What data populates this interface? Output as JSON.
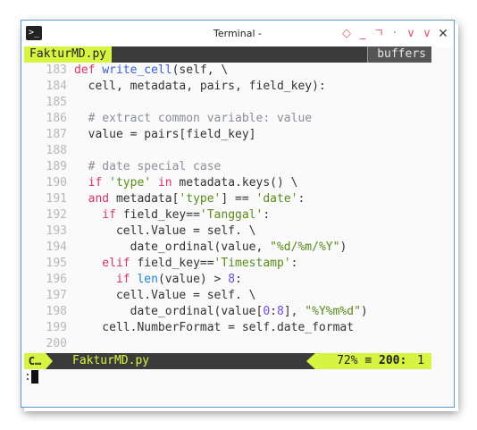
{
  "window": {
    "title": "Terminal -",
    "icon": "terminal-icon"
  },
  "window_buttons": [
    "◇",
    "_",
    "ㄱ",
    "·",
    "∨",
    "∨"
  ],
  "tabline": {
    "active_tab": "FakturMD.py",
    "buffers_label": "buffers"
  },
  "lines": [
    {
      "n": "183",
      "segs": [
        [
          "kw",
          "def "
        ],
        [
          "fn",
          "write_cell"
        ],
        [
          "",
          "(self, \\"
        ]
      ]
    },
    {
      "n": "184",
      "segs": [
        [
          "",
          "  cell, metadata, pairs, field_key):"
        ]
      ]
    },
    {
      "n": "185",
      "segs": []
    },
    {
      "n": "186",
      "segs": [
        [
          "cm",
          "  # extract common variable: value"
        ]
      ]
    },
    {
      "n": "187",
      "segs": [
        [
          "",
          "  value = pairs[field_key]"
        ]
      ]
    },
    {
      "n": "188",
      "segs": []
    },
    {
      "n": "189",
      "segs": [
        [
          "cm",
          "  # date special case"
        ]
      ]
    },
    {
      "n": "190",
      "segs": [
        [
          "kw",
          "  if "
        ],
        [
          "st",
          "'type'"
        ],
        [
          "kw",
          " in "
        ],
        [
          "",
          "metadata.keys() \\"
        ]
      ]
    },
    {
      "n": "191",
      "segs": [
        [
          "kw",
          "  and "
        ],
        [
          "",
          "metadata["
        ],
        [
          "st",
          "'type'"
        ],
        [
          "",
          "] == "
        ],
        [
          "st",
          "'date'"
        ],
        [
          "",
          ":"
        ]
      ]
    },
    {
      "n": "192",
      "segs": [
        [
          "kw",
          "    if "
        ],
        [
          "",
          "field_key=="
        ],
        [
          "st",
          "'Tanggal'"
        ],
        [
          "",
          ":"
        ]
      ]
    },
    {
      "n": "193",
      "segs": [
        [
          "",
          "      cell.Value = self. \\"
        ]
      ]
    },
    {
      "n": "194",
      "segs": [
        [
          "",
          "        date_ordinal(value, "
        ],
        [
          "st",
          "\"%d/%m/%Y\""
        ],
        [
          "",
          ")"
        ]
      ]
    },
    {
      "n": "195",
      "segs": [
        [
          "kw",
          "    elif "
        ],
        [
          "",
          "field_key=="
        ],
        [
          "st",
          "'Timestamp'"
        ],
        [
          "",
          ":"
        ]
      ]
    },
    {
      "n": "196",
      "segs": [
        [
          "kw",
          "      if "
        ],
        [
          "bi",
          "len"
        ],
        [
          "",
          "(value) > "
        ],
        [
          "nm",
          "8"
        ],
        [
          "",
          ":"
        ]
      ]
    },
    {
      "n": "197",
      "segs": [
        [
          "",
          "      cell.Value = self. \\"
        ]
      ]
    },
    {
      "n": "198",
      "segs": [
        [
          "",
          "        date_ordinal(value["
        ],
        [
          "nm",
          "0"
        ],
        [
          "",
          ":"
        ],
        [
          "nm",
          "8"
        ],
        [
          "",
          "], "
        ],
        [
          "st",
          "\"%Y%m%d\""
        ],
        [
          "",
          ")"
        ]
      ]
    },
    {
      "n": "199",
      "segs": [
        [
          "",
          "    cell.NumberFormat = self.date_format"
        ]
      ]
    },
    {
      "n": "200",
      "segs": []
    }
  ],
  "statusline": {
    "mode": "C…",
    "file": "FakturMD.py",
    "percent": "72%",
    "menu_icon": "≡",
    "line": "200:",
    "col": "1"
  },
  "cmdline": {
    "text": ":"
  }
}
